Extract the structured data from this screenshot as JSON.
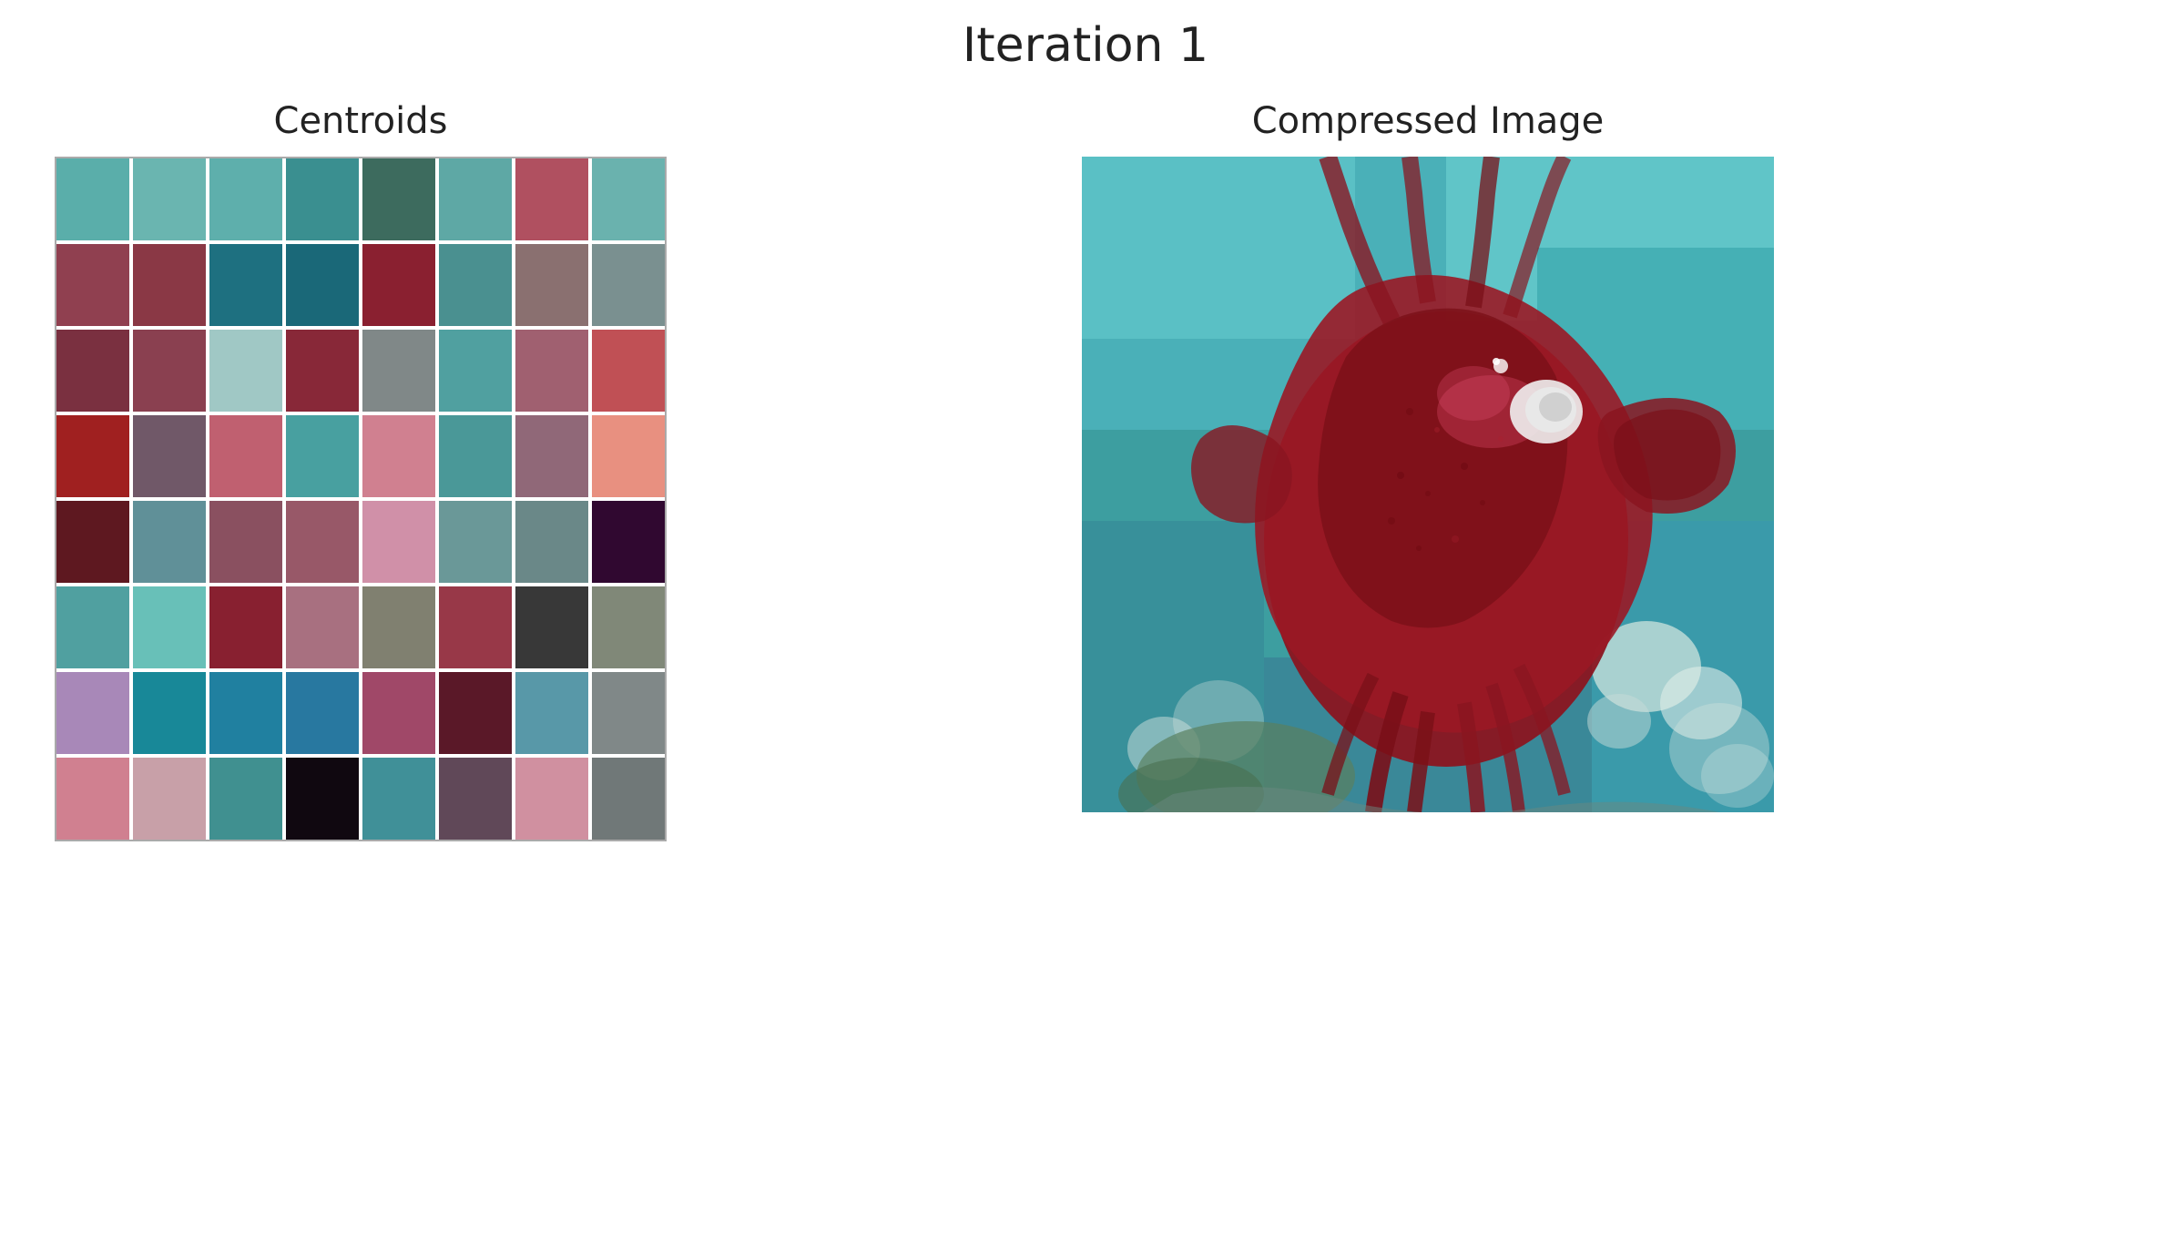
{
  "header": {
    "title": "Iteration 1"
  },
  "left_panel": {
    "label": "Centroids",
    "grid": {
      "cols": 8,
      "rows": 8,
      "colors": [
        "#5aaeaa",
        "#6ab5b0",
        "#5eafac",
        "#3a8f90",
        "#3d6b5e",
        "#5ea8a5",
        "#b05060",
        "#6ab2ae",
        "#904050",
        "#8a3845",
        "#1e7080",
        "#1a6878",
        "#8a2030",
        "#4a9090",
        "#8a7070",
        "#7a9090",
        "#7a3040",
        "#8a4050",
        "#a0c8c5",
        "#882838",
        "#808888",
        "#50a0a0",
        "#a06070",
        "#c05055",
        "#a02020",
        "#705868",
        "#c06070",
        "#48a0a0",
        "#d08090",
        "#4a9898",
        "#906878",
        "#e89080",
        "#5e1820",
        "#609098",
        "#8a5060",
        "#985868",
        "#d090a8",
        "#6a9898",
        "#6a8888",
        "#300830",
        "#50a0a0",
        "#68c0b8",
        "#882030",
        "#a87080",
        "#808070",
        "#983848",
        "#383838",
        "#808878",
        "#a888b8",
        "#188898",
        "#2080a0",
        "#2878a0",
        "#a04868",
        "#5a1828",
        "#5898a8",
        "#808888",
        "#d08090",
        "#c8a0a8",
        "#409090",
        "#100810",
        "#409098",
        "#604858",
        "#d090a0",
        "#707878"
      ]
    }
  },
  "right_panel": {
    "label": "Compressed Image"
  }
}
